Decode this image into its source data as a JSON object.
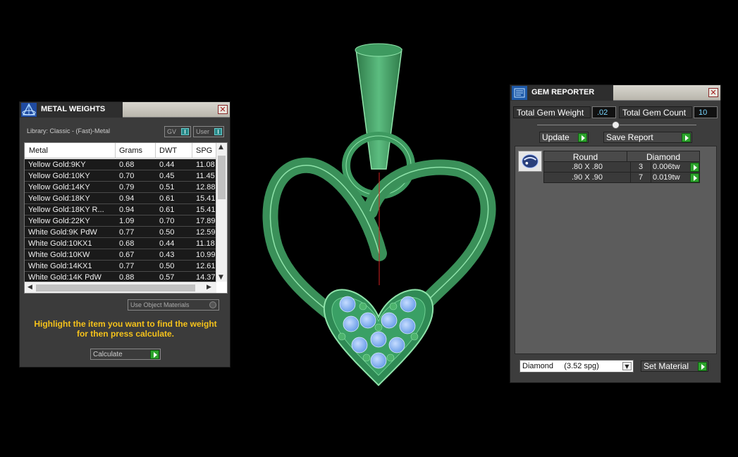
{
  "metal_weights": {
    "title": "METAL WEIGHTS",
    "close": "✕",
    "library_label": "Library: Classic - (Fast)-Metal",
    "toggle_gv": "GV",
    "toggle_user": "User",
    "columns": [
      "Metal",
      "Grams",
      "DWT",
      "SPG"
    ],
    "rows": [
      {
        "metal": "Yellow Gold:9KY",
        "grams": "0.68",
        "dwt": "0.44",
        "spg": "11.08"
      },
      {
        "metal": "Yellow Gold:10KY",
        "grams": "0.70",
        "dwt": "0.45",
        "spg": "11.45"
      },
      {
        "metal": "Yellow Gold:14KY",
        "grams": "0.79",
        "dwt": "0.51",
        "spg": "12.88"
      },
      {
        "metal": "Yellow Gold:18KY",
        "grams": "0.94",
        "dwt": "0.61",
        "spg": "15.41"
      },
      {
        "metal": "Yellow Gold:18KY R...",
        "grams": "0.94",
        "dwt": "0.61",
        "spg": "15.41"
      },
      {
        "metal": "Yellow Gold:22KY",
        "grams": "1.09",
        "dwt": "0.70",
        "spg": "17.89"
      },
      {
        "metal": "White Gold:9K PdW",
        "grams": "0.77",
        "dwt": "0.50",
        "spg": "12.59"
      },
      {
        "metal": "White Gold:10KX1",
        "grams": "0.68",
        "dwt": "0.44",
        "spg": "11.18"
      },
      {
        "metal": "White Gold:10KW",
        "grams": "0.67",
        "dwt": "0.43",
        "spg": "10.99"
      },
      {
        "metal": "White Gold:14KX1",
        "grams": "0.77",
        "dwt": "0.50",
        "spg": "12.61"
      },
      {
        "metal": "White Gold:14K PdW",
        "grams": "0.88",
        "dwt": "0.57",
        "spg": "14.37"
      }
    ],
    "use_object_materials": "Use Object Materials",
    "hint_line1": "Highlight the item you want to find the weight",
    "hint_line2": "for then press calculate.",
    "calculate": "Calculate"
  },
  "gem_reporter": {
    "title": "GEM REPORTER",
    "close": "✕",
    "total_weight_label": "Total Gem Weight",
    "total_weight_value": ".02",
    "total_count_label": "Total Gem Count",
    "total_count_value": "10",
    "update": "Update",
    "save_report": "Save Report",
    "shape": "Round",
    "material": "Diamond",
    "gems": [
      {
        "size": ".80 X .80",
        "count": "3",
        "weight": "0.006tw"
      },
      {
        "size": ".90 X .90",
        "count": "7",
        "weight": "0.019tw"
      }
    ],
    "material_select": "Diamond     (3.52 spg)",
    "set_material": "Set Material"
  },
  "colors": {
    "metal_green": "#3f9a5f",
    "gem_blue": "#7fb2f0",
    "hint_yellow": "#f5c21b",
    "go_green": "#2da42d"
  }
}
